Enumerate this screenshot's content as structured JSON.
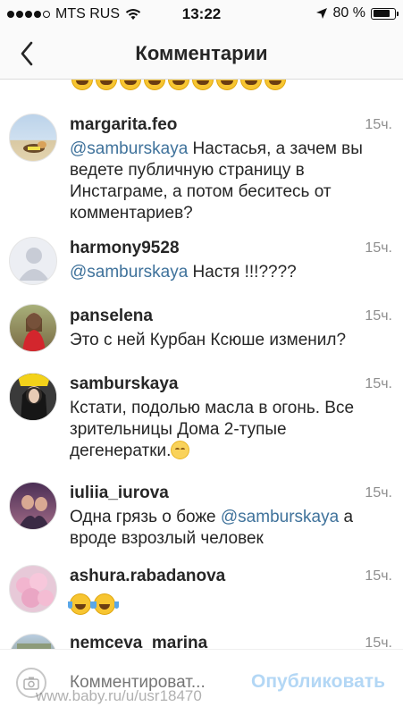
{
  "status_bar": {
    "carrier": "MTS RUS",
    "time": "13:22",
    "battery": "80 %",
    "battery_level": 0.8,
    "signal_bars_filled": 4,
    "signal_bars_total": 5
  },
  "nav": {
    "title": "Комментарии"
  },
  "comments": [
    {
      "username": "margarita.feo",
      "time": "15ч.",
      "mention": "@samburskaya",
      "text": " Настасья, а зачем вы ведете публичную страницу в Инстаграме, а потом беситесь от комментариев?"
    },
    {
      "username": "harmony9528",
      "time": "15ч.",
      "mention": "@samburskaya",
      "text": " Настя !!!????"
    },
    {
      "username": "panselena",
      "time": "15ч.",
      "text": "Это с ней Курбан Ксюше изменил?"
    },
    {
      "username": "samburskaya",
      "time": "15ч.",
      "text": "Кстати, подолью масла в огонь. Все зрительницы Дома 2-тупые дегенератки."
    },
    {
      "username": "iuliia_iurova",
      "time": "15ч.",
      "text_before": "Одна грязь о боже ",
      "mention": "@samburskaya",
      "text_after": " а вроде взрозлый человек"
    },
    {
      "username": "ashura.rabadanova",
      "time": "15ч."
    },
    {
      "username": "nemceva_marina",
      "time": "15ч."
    }
  ],
  "input": {
    "placeholder": "Комментироват...",
    "publish_label": "Опубликовать"
  },
  "watermark": "www.baby.ru/u/usr18470",
  "colors": {
    "accent_link": "#3f729b",
    "publish_disabled": "#b3d7f5",
    "time_gray": "#8e8e8e"
  }
}
